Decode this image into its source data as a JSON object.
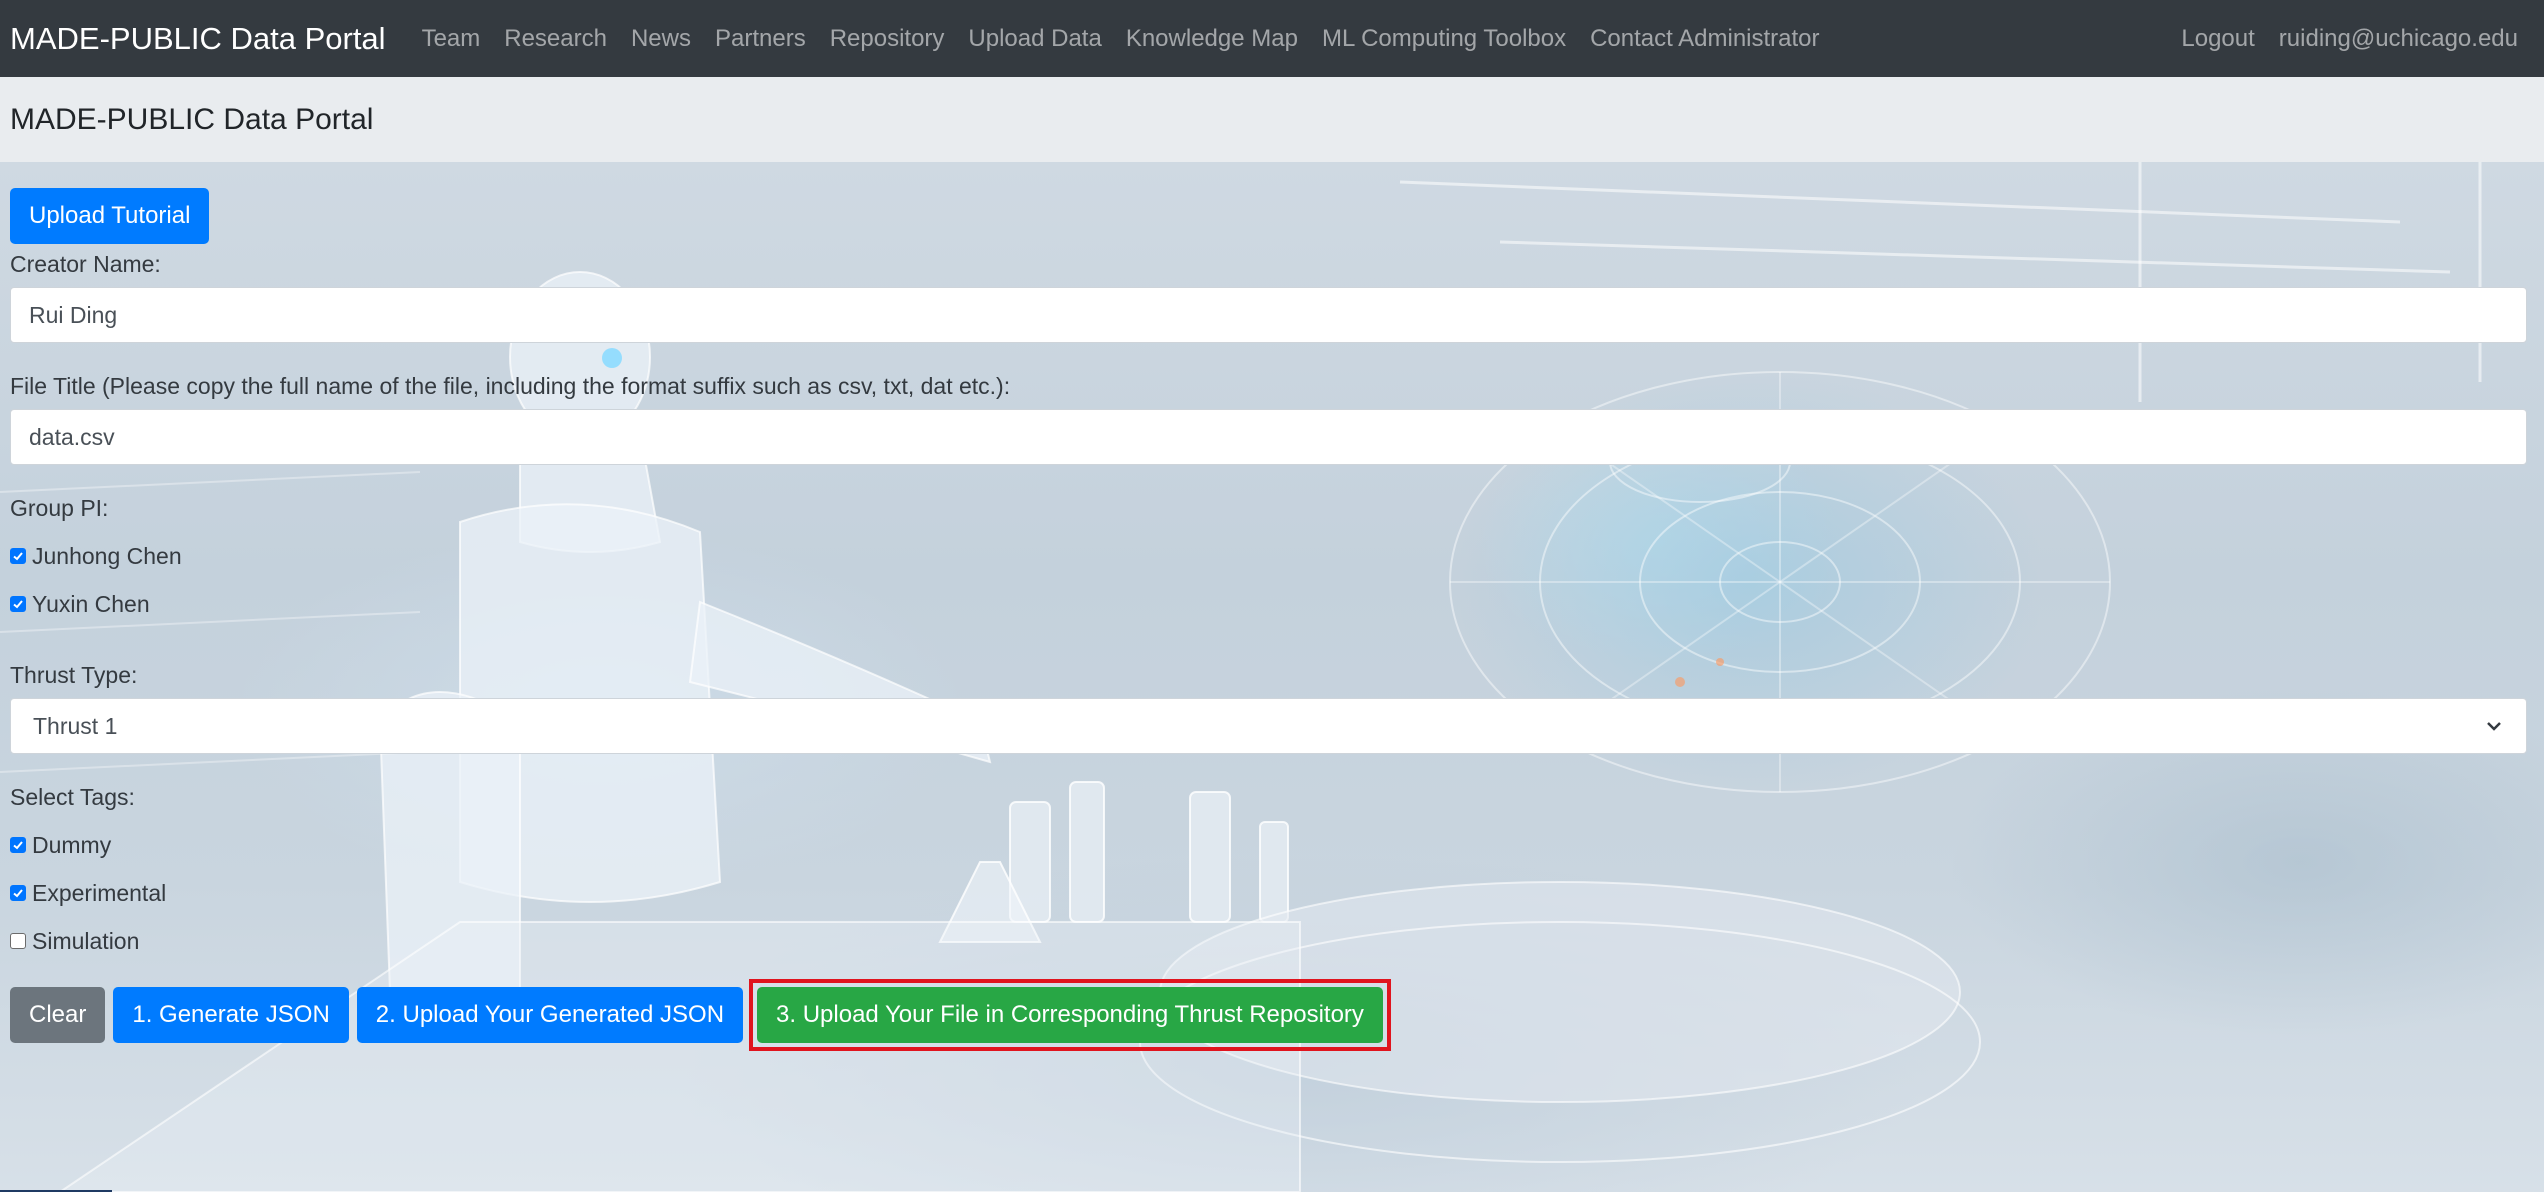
{
  "navbar": {
    "brand": "MADE-PUBLIC Data Portal",
    "links": [
      "Team",
      "Research",
      "News",
      "Partners",
      "Repository",
      "Upload Data",
      "Knowledge Map",
      "ML Computing Toolbox",
      "Contact Administrator"
    ],
    "logout": "Logout",
    "user_email": "ruiding@uchicago.edu"
  },
  "page_header": {
    "title": "MADE-PUBLIC Data Portal"
  },
  "form": {
    "tutorial_button": "Upload Tutorial",
    "creator_label": "Creator Name:",
    "creator_value": "Rui Ding",
    "file_title_label": "File Title (Please copy the full name of the file, including the format suffix such as csv, txt, dat etc.):",
    "file_title_value": "data.csv",
    "group_pi_label": "Group PI:",
    "group_pi_options": [
      {
        "label": "Junhong Chen",
        "checked": true
      },
      {
        "label": "Yuxin Chen",
        "checked": true
      }
    ],
    "thrust_label": "Thrust Type:",
    "thrust_selected": "Thrust 1",
    "tags_label": "Select Tags:",
    "tags": [
      {
        "label": "Dummy",
        "checked": true
      },
      {
        "label": "Experimental",
        "checked": true
      },
      {
        "label": "Simulation",
        "checked": false
      }
    ],
    "buttons": {
      "clear": "Clear",
      "generate_json": "1. Generate JSON",
      "upload_json": "2. Upload Your Generated JSON",
      "upload_file": "3. Upload Your File in Corresponding Thrust Repository"
    }
  },
  "colors": {
    "navbar_bg": "#343a40",
    "header_bg": "#e9ecef",
    "primary": "#007bff",
    "secondary": "#6c757d",
    "success": "#28a745",
    "highlight": "#e0141e"
  }
}
